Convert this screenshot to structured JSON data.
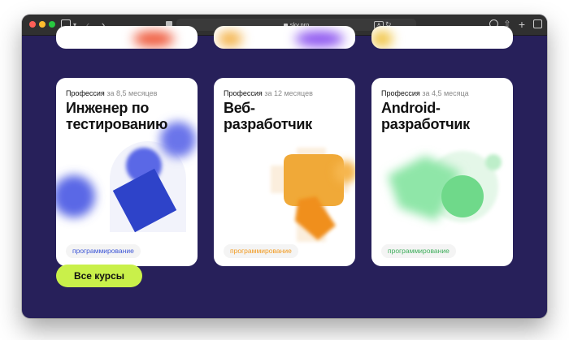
{
  "browser": {
    "address": "sky.pro"
  },
  "colors": {
    "page_bg": "#27205a",
    "accent_button": "#c9f04a",
    "tag_blue": "#3c55d6",
    "tag_orange": "#f29a1f",
    "tag_green": "#3fae5c"
  },
  "cards": [
    {
      "label": "Профессия",
      "duration": "за 8,5 месяцев",
      "title": "Инженер по тестированию",
      "tag": "программирование"
    },
    {
      "label": "Профессия",
      "duration": "за 12 месяцев",
      "title": "Веб-разработчик",
      "tag": "программирование"
    },
    {
      "label": "Профессия",
      "duration": "за 4,5 месяца",
      "title": "Android-разработчик",
      "tag": "программирование"
    }
  ],
  "all_courses_button": "Все курсы"
}
